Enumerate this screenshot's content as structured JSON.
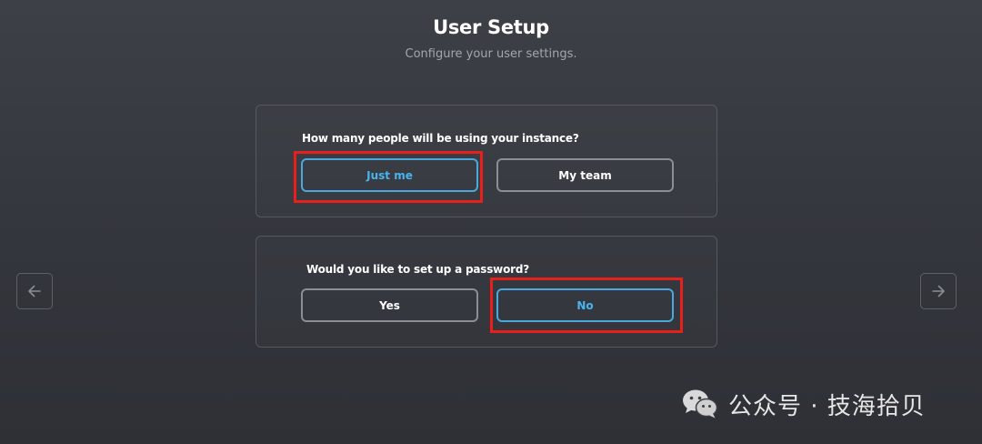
{
  "header": {
    "title": "User Setup",
    "subtitle": "Configure your user settings."
  },
  "questions": [
    {
      "label": "How many people will be using your instance?",
      "options": [
        "Just me",
        "My team"
      ],
      "selected": "Just me"
    },
    {
      "label": "Would you like to set up a password?",
      "options": [
        "Yes",
        "No"
      ],
      "selected": "No"
    }
  ],
  "navigation": {
    "prev_icon": "arrow-left-icon",
    "next_icon": "arrow-right-icon"
  },
  "watermark": {
    "icon": "wechat-icon",
    "text": "公众号 · 技海拾贝"
  },
  "colors": {
    "background": "#36393f",
    "selected_accent": "#4aa8dc",
    "highlight_box": "#e8201c",
    "card_border": "#55585f"
  }
}
